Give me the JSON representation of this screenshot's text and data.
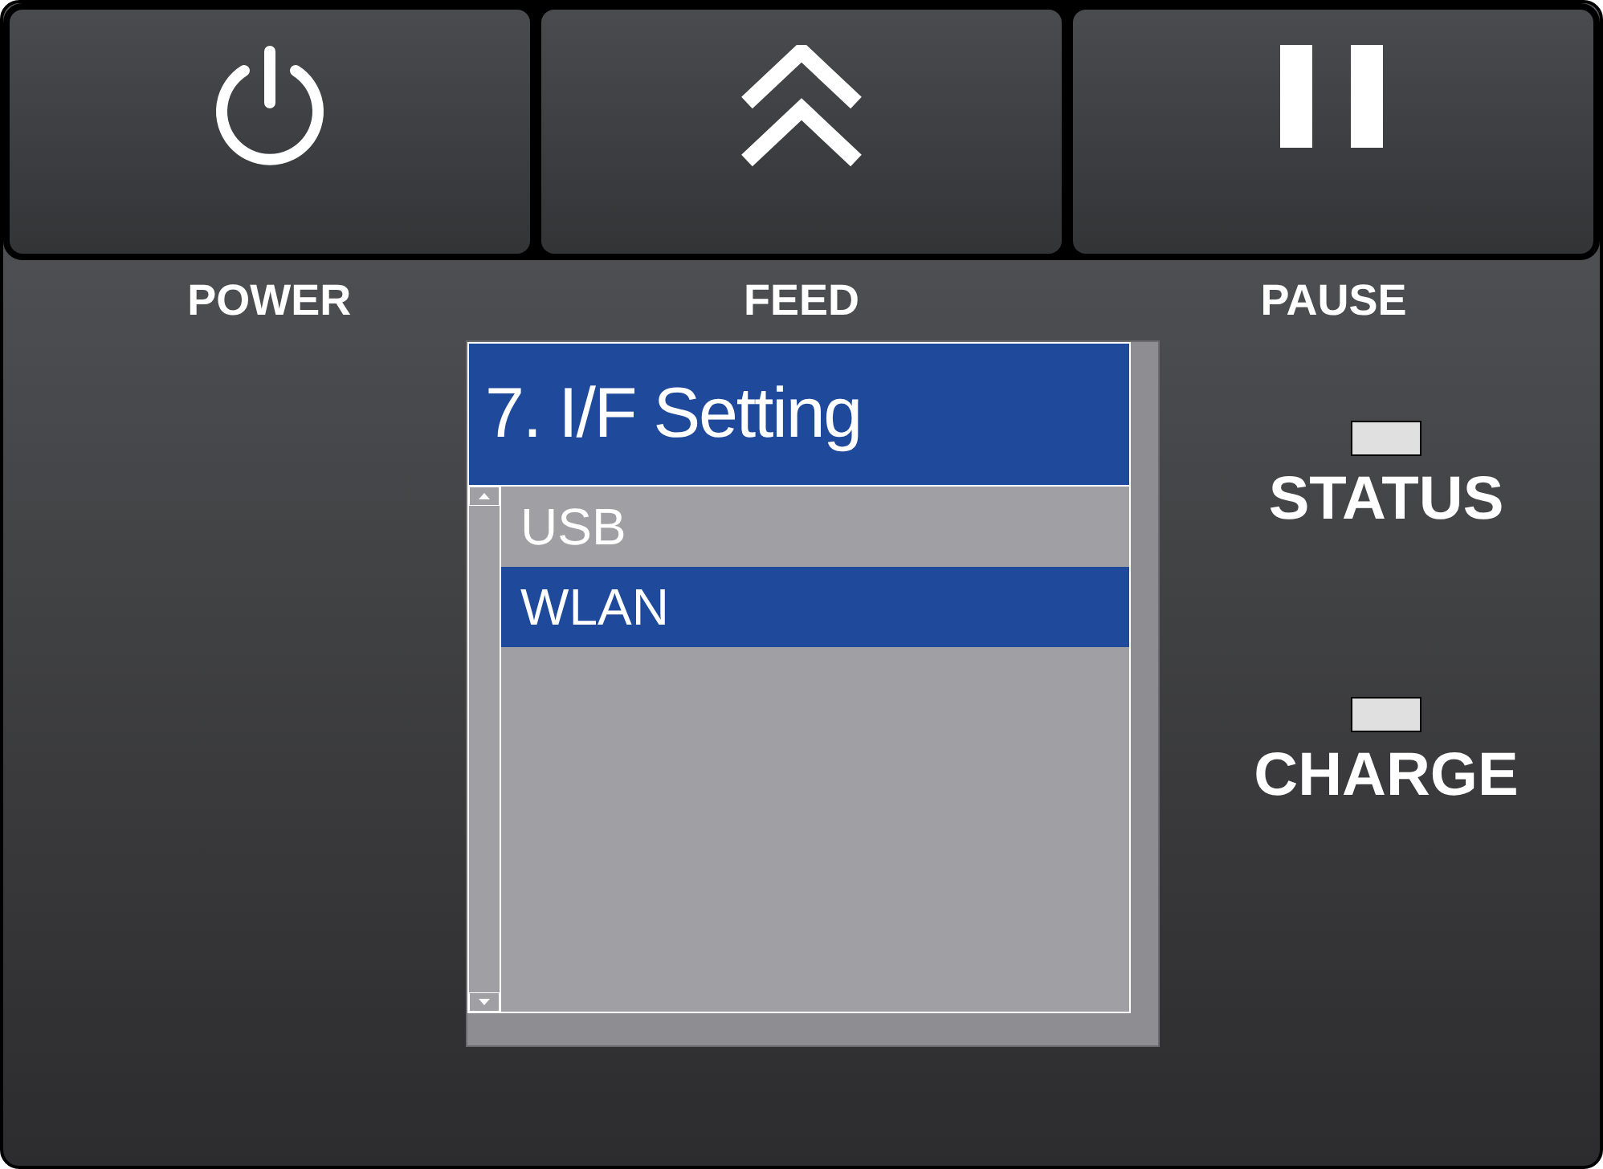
{
  "buttons": [
    {
      "kind": "power",
      "label": "POWER"
    },
    {
      "kind": "feed",
      "label": "FEED"
    },
    {
      "kind": "pause",
      "label": "PAUSE"
    }
  ],
  "display": {
    "title": "7. I/F Setting",
    "items": [
      {
        "label": "USB",
        "selected": false
      },
      {
        "label": "WLAN",
        "selected": true
      }
    ]
  },
  "indicators": [
    {
      "label": "STATUS"
    },
    {
      "label": "CHARGE"
    }
  ]
}
